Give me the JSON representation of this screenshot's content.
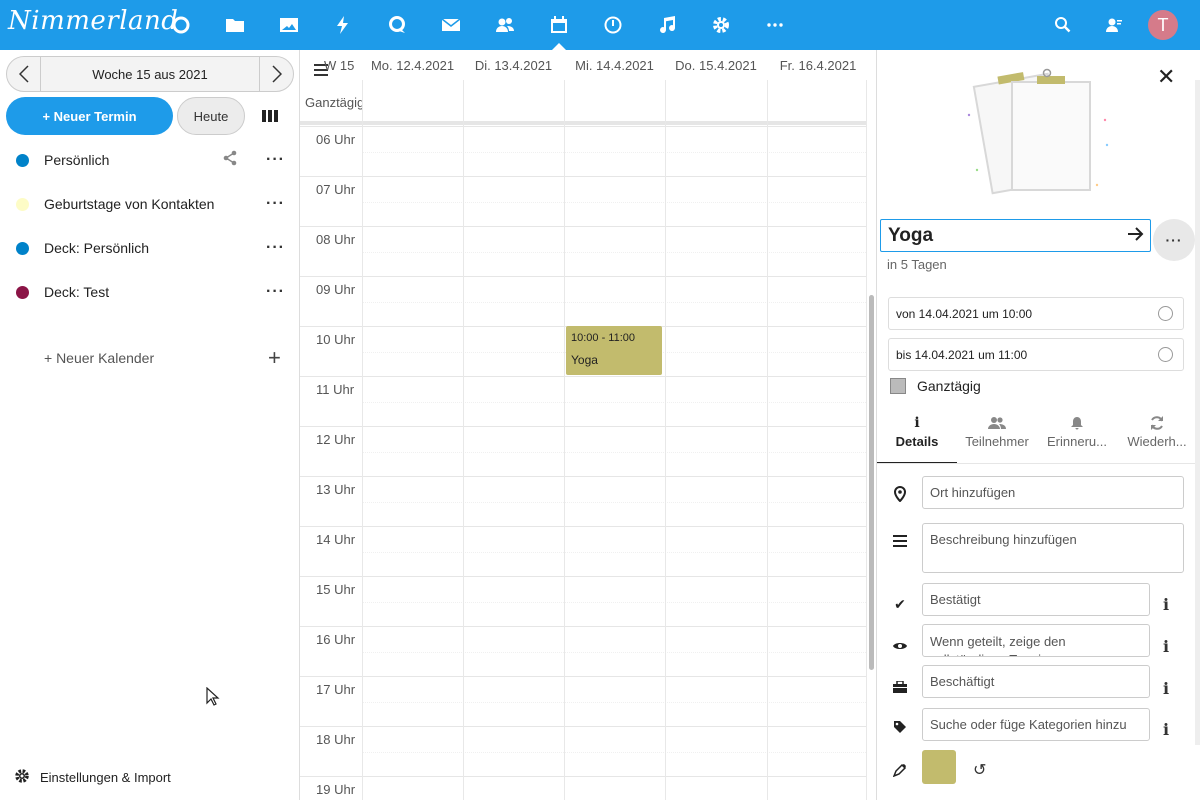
{
  "app": {
    "logo_text": "Nimmerland",
    "user_initial": "T",
    "accent": "#1e9be9"
  },
  "topbar": {
    "apps": [
      "dashboard-icon",
      "files-icon",
      "photos-icon",
      "activity-icon",
      "talk-icon",
      "mail-icon",
      "contacts-icon",
      "calendar-icon",
      "clock-icon",
      "music-icon",
      "settings-icon",
      "more-apps-icon"
    ],
    "right_icons": [
      "search-icon",
      "contacts-menu-icon"
    ]
  },
  "sidebar": {
    "week_label": "Woche 15 aus 2021",
    "new_event": "+ Neuer Termin",
    "today": "Heute",
    "calendars": [
      {
        "name": "Persönlich",
        "color": "#0082c9"
      },
      {
        "name": "Geburtstage von Kontakten",
        "color": "#fdfcc6"
      },
      {
        "name": "Deck: Persönlich",
        "color": "#0082c9"
      },
      {
        "name": "Deck: Test",
        "color": "#8b1446"
      }
    ],
    "new_calendar": "+ Neuer Kalender",
    "settings": "Einstellungen & Import"
  },
  "grid": {
    "week": "W 15",
    "allday": "Ganztägig",
    "days": [
      "Mo. 12.4.2021",
      "Di. 13.4.2021",
      "Mi. 14.4.2021",
      "Do. 15.4.2021",
      "Fr. 16.4.2021"
    ],
    "hours": [
      "06 Uhr",
      "07 Uhr",
      "08 Uhr",
      "09 Uhr",
      "10 Uhr",
      "11 Uhr",
      "12 Uhr",
      "13 Uhr",
      "14 Uhr",
      "15 Uhr",
      "16 Uhr",
      "17 Uhr",
      "18 Uhr",
      "19 Uhr"
    ],
    "event": {
      "time": "10:00 - 11:00",
      "title": "Yoga",
      "color": "#c2bb6d"
    }
  },
  "panel": {
    "title": "Yoga",
    "relative": "in 5 Tagen",
    "from": "von 14.04.2021 um 10:00",
    "to": "bis 14.04.2021 um 11:00",
    "allday": "Ganztägig",
    "tabs": [
      "Details",
      "Teilnehmer",
      "Erinneru...",
      "Wiederh..."
    ],
    "location_placeholder": "Ort hinzufügen",
    "description_placeholder": "Beschreibung hinzufügen",
    "status": "Bestätigt",
    "visibility": "Wenn geteilt, zeige den vollständigen Termin",
    "busy": "Beschäftigt",
    "categories_placeholder": "Suche oder füge Kategorien hinzu",
    "color": "#c2bb6d"
  }
}
